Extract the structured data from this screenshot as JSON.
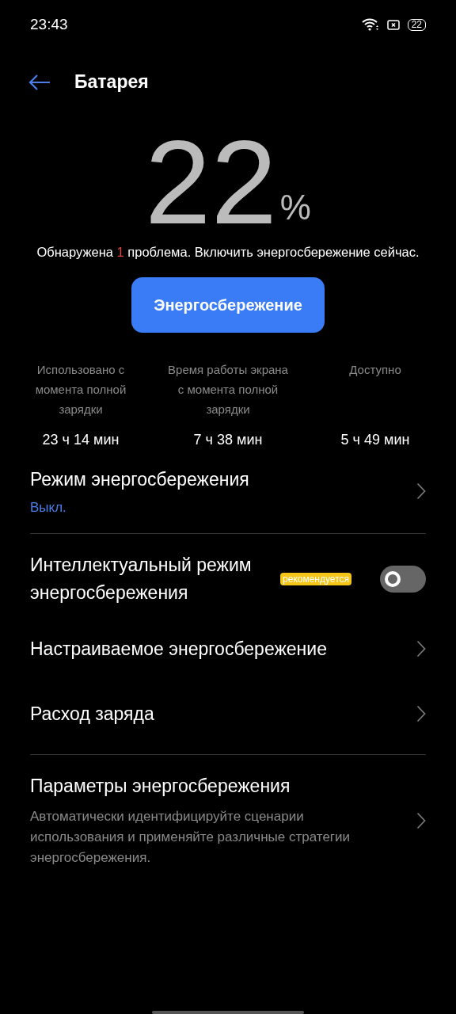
{
  "status_bar": {
    "time": "23:43",
    "battery": "22"
  },
  "header": {
    "title": "Батарея"
  },
  "charge": {
    "value": "22",
    "unit": "%"
  },
  "problem": {
    "before": "Обнаружена",
    "count": "1",
    "after": "проблема. Включить энергосбережение сейчас."
  },
  "primary_button": "Энергосбережение",
  "stats": [
    {
      "label": "Использовано с момента полной зарядки",
      "value": "23 ч 14 мин"
    },
    {
      "label": "Время работы экрана с момента полной зарядки",
      "value": "7 ч 38 мин"
    },
    {
      "label": "Доступно",
      "value": "5 ч 49 мин"
    }
  ],
  "groups": [
    {
      "items": [
        {
          "kind": "nav",
          "title": "Режим энергосбережения",
          "value": "Выкл."
        }
      ]
    },
    {
      "items": [
        {
          "kind": "toggle",
          "title": "Интеллектуальный режим энергосбережения",
          "badge": "рекомендуется",
          "on": false
        },
        {
          "kind": "nav",
          "title": "Настраиваемое энергосбережение"
        },
        {
          "kind": "nav",
          "title": "Расход заряда"
        }
      ]
    },
    {
      "items": [
        {
          "kind": "nav",
          "title": "Параметры энергосбережения",
          "description": "Автоматически идентифицируйте сценарии использования и применяйте различные стратегии энергосбережения."
        }
      ]
    }
  ]
}
